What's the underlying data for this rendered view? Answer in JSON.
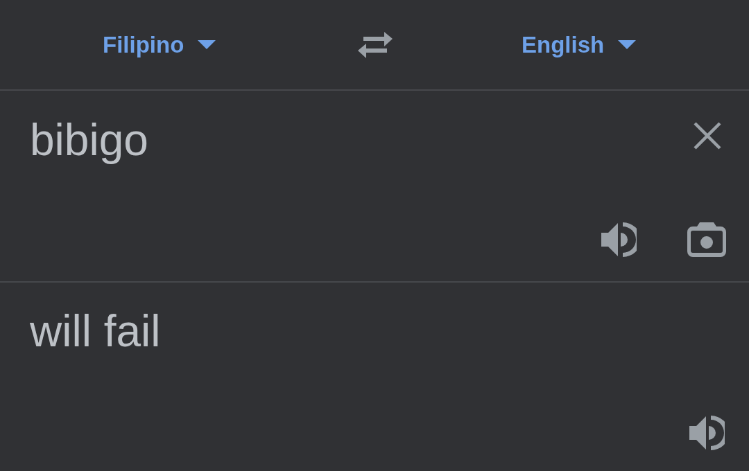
{
  "language_bar": {
    "source_language": "Filipino",
    "target_language": "English"
  },
  "source": {
    "text": "bibigo"
  },
  "translation": {
    "text": "will fail"
  }
}
